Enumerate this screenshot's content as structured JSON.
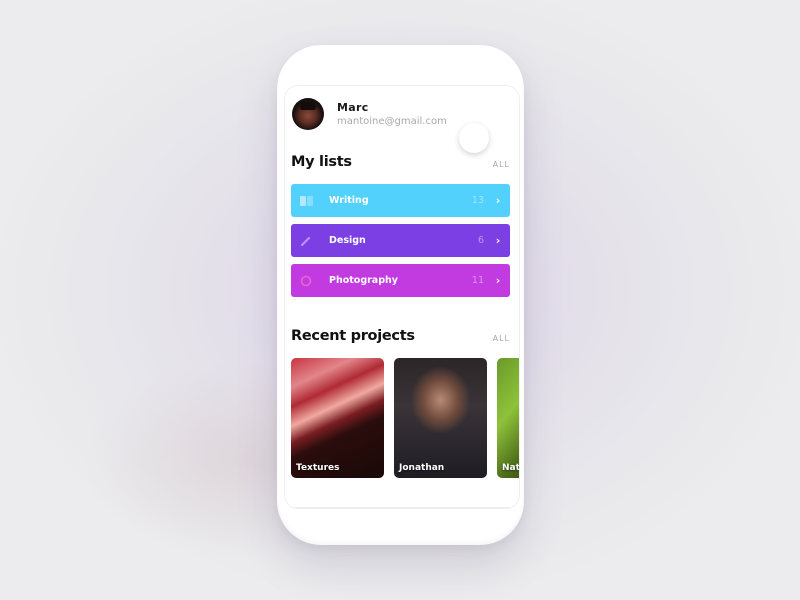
{
  "profile": {
    "name": "Marc",
    "email": "mantoine@gmail.com"
  },
  "my_lists": {
    "title": "My lists",
    "all_label": "ALL",
    "items": [
      {
        "label": "Writing",
        "count": "13",
        "icon": "book-icon",
        "color": "#52d1fc"
      },
      {
        "label": "Design",
        "count": "6",
        "icon": "pencil-icon",
        "color": "#7b3fe4"
      },
      {
        "label": "Photography",
        "count": "11",
        "icon": "camera-icon",
        "color": "#c23be0"
      }
    ]
  },
  "recent_projects": {
    "title": "Recent projects",
    "all_label": "ALL",
    "cards": [
      {
        "label": "Textures"
      },
      {
        "label": "Jonathan"
      },
      {
        "label": "Nature"
      }
    ]
  }
}
